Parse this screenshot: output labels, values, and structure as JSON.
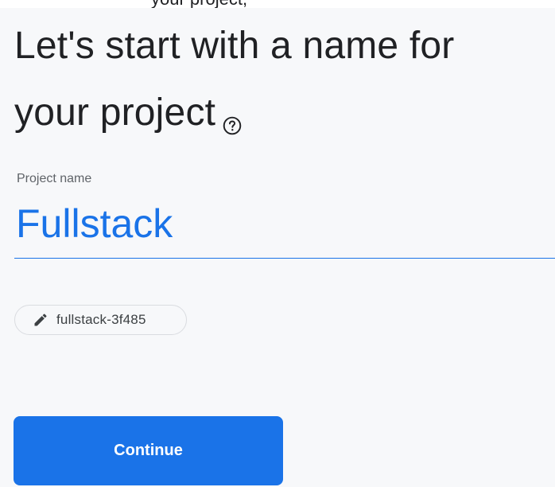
{
  "header": {
    "clipped_text": "your project, "
  },
  "heading": {
    "line1": "Let's start with a name for",
    "line2": "your project",
    "help_icon": "help-circle-icon"
  },
  "project_name": {
    "label": "Project name",
    "value": "Fullstack"
  },
  "project_id_chip": {
    "icon": "pencil-icon",
    "text": "fullstack-3f485"
  },
  "actions": {
    "continue_label": "Continue"
  },
  "colors": {
    "accent": "#1a73e8",
    "background": "#f7f8fa",
    "text": "#202124",
    "label": "#5f6368",
    "chip_border": "#dadce0"
  }
}
